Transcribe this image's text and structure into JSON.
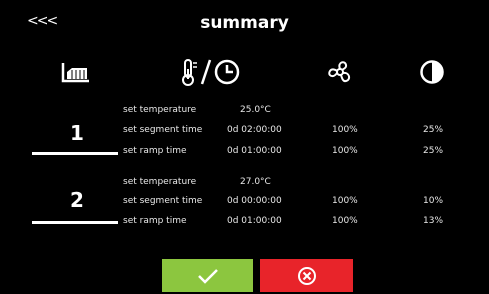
{
  "header": {
    "back_label": "<<<",
    "title": "summary"
  },
  "columns": {
    "icons": [
      "segment-chart-icon",
      "temperature-time-icon",
      "fan-icon",
      "flap-icon"
    ]
  },
  "segments": [
    {
      "number": "1",
      "rows": [
        {
          "label": "set temperature",
          "value": "25.0°C",
          "fan": "",
          "flap": ""
        },
        {
          "label": "set segment time",
          "value": "0d 02:00:00",
          "fan": "100%",
          "flap": "25%"
        },
        {
          "label": "set ramp time",
          "value": "0d 01:00:00",
          "fan": "100%",
          "flap": "25%"
        }
      ]
    },
    {
      "number": "2",
      "rows": [
        {
          "label": "set temperature",
          "value": "27.0°C",
          "fan": "",
          "flap": ""
        },
        {
          "label": "set segment time",
          "value": "0d 00:00:00",
          "fan": "100%",
          "flap": "10%"
        },
        {
          "label": "set ramp time",
          "value": "0d 01:00:00",
          "fan": "100%",
          "flap": "13%"
        }
      ]
    }
  ],
  "buttons": {
    "confirm_color": "#8cc63f",
    "cancel_color": "#e8242a"
  }
}
